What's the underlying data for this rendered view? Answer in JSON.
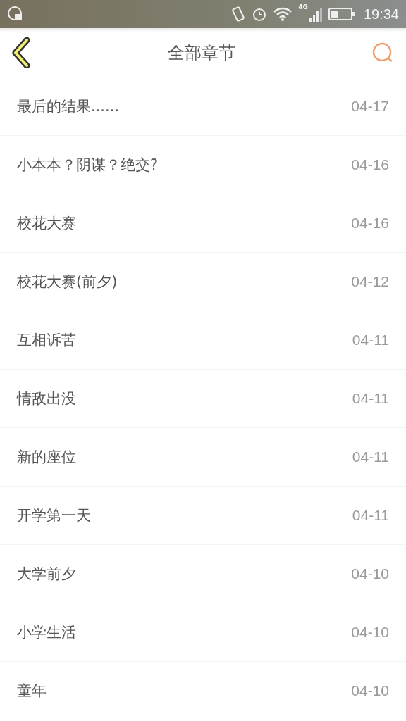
{
  "status_bar": {
    "network": "4G",
    "time": "19:34"
  },
  "header": {
    "title": "全部章节"
  },
  "chapters": [
    {
      "title": "最后的结果......",
      "date": "04-17"
    },
    {
      "title": "小本本？阴谋？绝交?",
      "date": "04-16"
    },
    {
      "title": "校花大赛",
      "date": "04-16"
    },
    {
      "title": "校花大赛(前夕)",
      "date": "04-12"
    },
    {
      "title": "互相诉苦",
      "date": "04-11"
    },
    {
      "title": "情敌出没",
      "date": "04-11"
    },
    {
      "title": "新的座位",
      "date": "04-11"
    },
    {
      "title": "开学第一天",
      "date": "04-11"
    },
    {
      "title": "大学前夕",
      "date": "04-10"
    },
    {
      "title": "小学生活",
      "date": "04-10"
    },
    {
      "title": "童年",
      "date": "04-10"
    }
  ]
}
